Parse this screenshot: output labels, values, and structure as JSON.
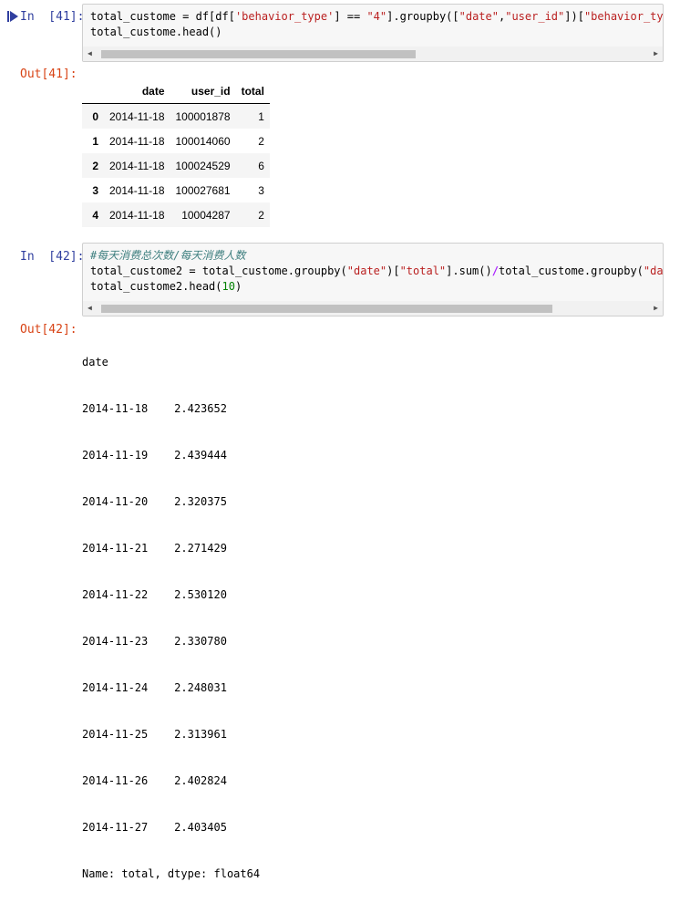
{
  "cells": [
    {
      "in_prompt": "In  [41]:",
      "code": {
        "line1_a": "total_custome = df[df[",
        "line1_s1": "'behavior_type'",
        "line1_b": "] == ",
        "line1_s2": "\"4\"",
        "line1_c": "].groupby([",
        "line1_s3": "\"date\"",
        "line1_d": ",",
        "line1_s4": "\"user_id\"",
        "line1_e": "])[",
        "line1_s5": "\"behavior_type\"",
        "line2": "total_custome.head()"
      },
      "out_prompt": "Out[41]:",
      "table": {
        "columns": [
          "date",
          "user_id",
          "total"
        ],
        "rows": [
          {
            "index": "0",
            "date": "2014-11-18",
            "user_id": "100001878",
            "total": "1"
          },
          {
            "index": "1",
            "date": "2014-11-18",
            "user_id": "100014060",
            "total": "2"
          },
          {
            "index": "2",
            "date": "2014-11-18",
            "user_id": "100024529",
            "total": "6"
          },
          {
            "index": "3",
            "date": "2014-11-18",
            "user_id": "100027681",
            "total": "3"
          },
          {
            "index": "4",
            "date": "2014-11-18",
            "user_id": "10004287",
            "total": "2"
          }
        ]
      }
    },
    {
      "in_prompt": "In  [42]:",
      "code": {
        "comment": "#每天消费总次数/每天消费人数",
        "line2_a": "total_custome2 = total_custome.groupby(",
        "line2_s1": "\"date\"",
        "line2_b": ")[",
        "line2_s2": "\"total\"",
        "line2_c": "].sum()",
        "line2_op": "/",
        "line2_d": "total_custome.groupby(",
        "line2_s3": "\"date\"",
        "line3_a": "total_custome2.head(",
        "line3_num": "10",
        "line3_b": ")"
      },
      "out_prompt": "Out[42]:",
      "series": {
        "header": "date",
        "rows": [
          {
            "date": "2014-11-18",
            "value": "2.423652"
          },
          {
            "date": "2014-11-19",
            "value": "2.439444"
          },
          {
            "date": "2014-11-20",
            "value": "2.320375"
          },
          {
            "date": "2014-11-21",
            "value": "2.271429"
          },
          {
            "date": "2014-11-22",
            "value": "2.530120"
          },
          {
            "date": "2014-11-23",
            "value": "2.330780"
          },
          {
            "date": "2014-11-24",
            "value": "2.248031"
          },
          {
            "date": "2014-11-25",
            "value": "2.313961"
          },
          {
            "date": "2014-11-26",
            "value": "2.402824"
          },
          {
            "date": "2014-11-27",
            "value": "2.403405"
          }
        ],
        "footer": "Name: total, dtype: float64"
      }
    }
  ],
  "scrollbar": {
    "left_arrow": "◀",
    "right_arrow": "▶"
  },
  "colors": {
    "in_prompt": "#303f9f",
    "out_prompt": "#d84315",
    "string": "#ba2121",
    "number": "#008000",
    "comment": "#408080"
  }
}
